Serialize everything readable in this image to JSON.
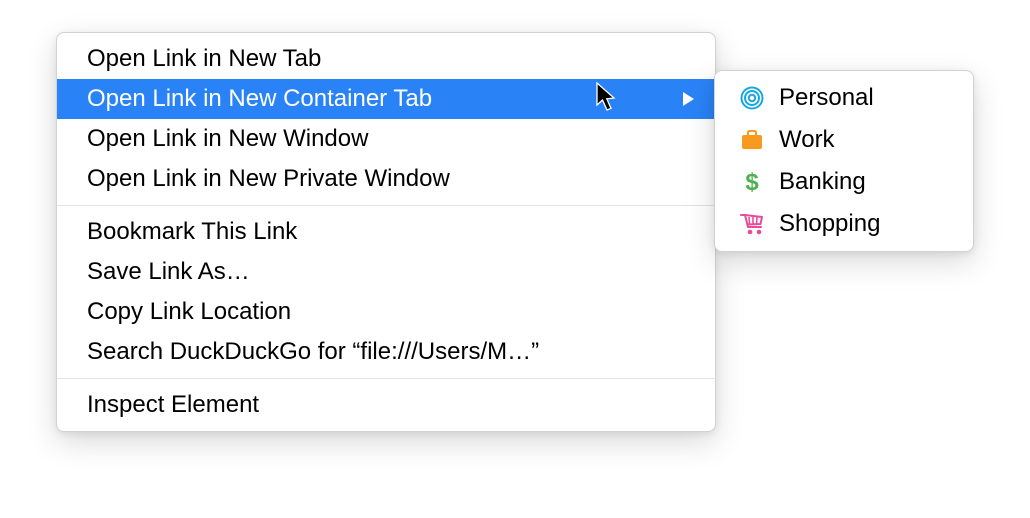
{
  "mainMenu": {
    "group1": [
      "Open Link in New Tab",
      "Open Link in New Container Tab",
      "Open Link in New Window",
      "Open Link in New Private Window"
    ],
    "group2": [
      "Bookmark This Link",
      "Save Link As…",
      "Copy Link Location",
      "Search DuckDuckGo for “file:///Users/M…”"
    ],
    "group3": [
      "Inspect Element"
    ],
    "highlightedIndex": 1
  },
  "submenu": {
    "items": [
      {
        "label": "Personal",
        "iconName": "fingerprint-icon",
        "color": "#13a9e0"
      },
      {
        "label": "Work",
        "iconName": "briefcase-icon",
        "color": "#f79a1e"
      },
      {
        "label": "Banking",
        "iconName": "dollar-icon",
        "color": "#4fb04f"
      },
      {
        "label": "Shopping",
        "iconName": "cart-icon",
        "color": "#ea4a9a"
      }
    ]
  }
}
